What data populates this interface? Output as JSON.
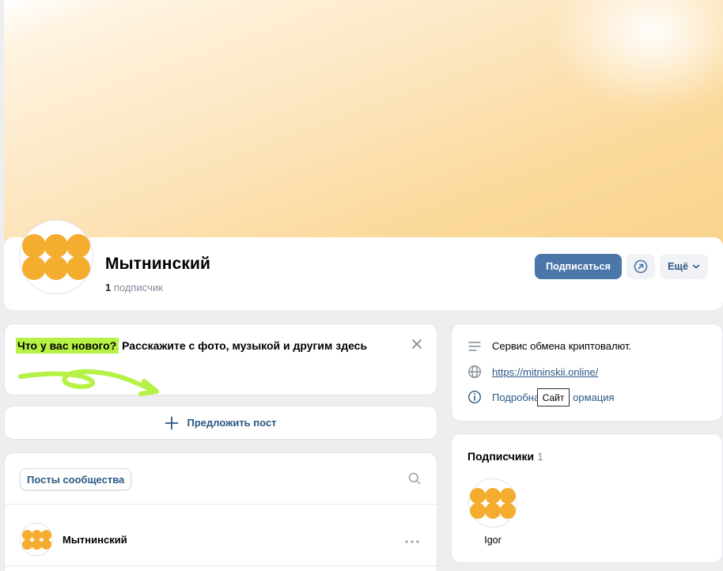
{
  "group": {
    "name": "Мытнинский",
    "subscribers_count": "1",
    "subscribers_label": "подписчик"
  },
  "actions": {
    "subscribe_label": "Подписаться",
    "more_label": "Ещё"
  },
  "composer": {
    "highlight_text": "Что у вас нового?",
    "prompt_text": "Расскажите с фото, музыкой и другим здесь"
  },
  "suggest_post": {
    "label": "Предложить пост"
  },
  "feed": {
    "tab_label": "Посты сообщества",
    "post_author": "Мытнинский"
  },
  "info": {
    "description": "Сервис обмена криптовалют.",
    "website": "https://mitninskii.online/",
    "more_info_start": "Подробна",
    "more_info_end": "ормация",
    "tooltip": "Сайт"
  },
  "followers": {
    "title": "Подписчики",
    "count": "1",
    "items": [
      {
        "name": "Igor"
      }
    ]
  },
  "colors": {
    "accent": "#4a76a8",
    "link": "#2a5885",
    "avatar_dots": "#f4ad2f",
    "highlight": "#b6f146",
    "background": "#edeef0"
  },
  "icons": {
    "share": "share-arrow-icon",
    "more_chevron": "chevron-down-icon",
    "close": "close-icon",
    "plus": "plus-icon",
    "search": "search-icon",
    "description": "text-lines-icon",
    "website": "globe-icon",
    "info": "info-icon",
    "post_menu": "more-horizontal-icon"
  }
}
